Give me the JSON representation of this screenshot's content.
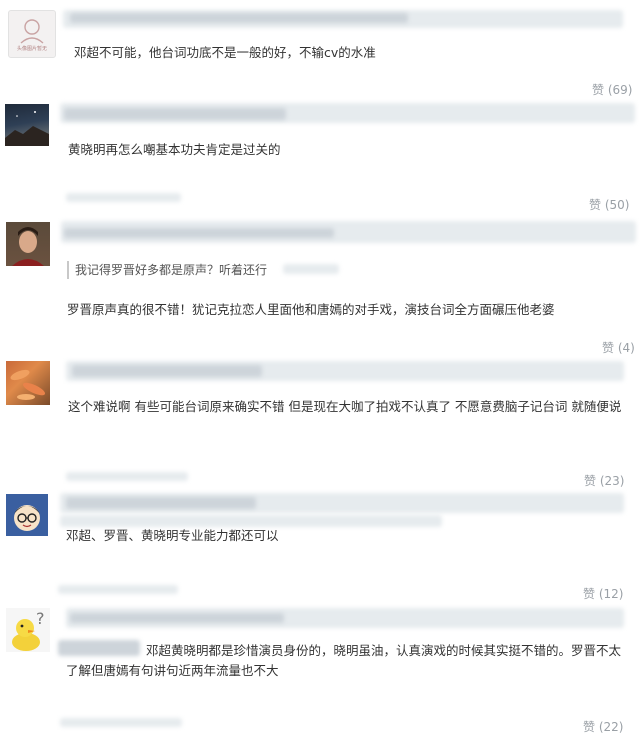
{
  "comments": [
    {
      "text": "邓超不可能，他台词功底不是一般的好，不输cv的水准",
      "likes": "赞 (69)",
      "avatar_caption": "头像图片暂无"
    },
    {
      "text": "黄晓明再怎么嘲基本功夫肯定是过关的",
      "likes": "赞 (50)"
    },
    {
      "quote": "我记得罗晋好多都是原声？听着还行",
      "text": "罗晋原声真的很不错！犹记克拉恋人里面他和唐嫣的对手戏，演技台词全方面碾压他老婆",
      "likes": "赞 (4)"
    },
    {
      "text": "这个难说啊 有些可能台词原来确实不错 但是现在大咖了拍戏不认真了 不愿意费脑子记台词 就随便说",
      "likes": "赞 (23)"
    },
    {
      "text": "邓超、罗晋、黄晓明专业能力都还可以",
      "likes": "赞 (12)"
    },
    {
      "text": "邓超黄晓明都是珍惜演员身份的，晓明虽油，认真演戏的时候其实挺不错的。罗晋不太了解但唐嫣有句讲句近两年流量也不大",
      "likes": "赞 (22)"
    }
  ]
}
